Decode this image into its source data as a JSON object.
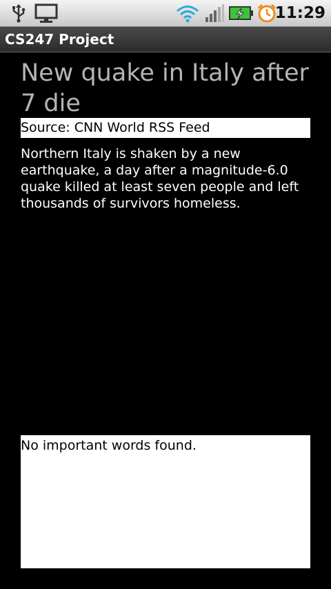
{
  "status_bar": {
    "time": "11:29",
    "icons": [
      "usb-icon",
      "monitor-icon",
      "wifi-icon",
      "signal-icon",
      "battery-charging-icon",
      "alarm-icon"
    ]
  },
  "app": {
    "title": "CS247 Project"
  },
  "article": {
    "headline": "New quake in Italy after 7 die",
    "source": "Source: CNN World RSS Feed",
    "summary": "Northern Italy is shaken by a new earthquake, a day after a magnitude-6.0 quake killed at least seven people and left thousands of survivors homeless."
  },
  "important_words": {
    "text": "No important words found."
  },
  "colors": {
    "background": "#000000",
    "headline": "#b5b5b5",
    "box_background": "#ffffff",
    "battery_charging": "#3cc43c",
    "alarm": "#f08a1c"
  }
}
